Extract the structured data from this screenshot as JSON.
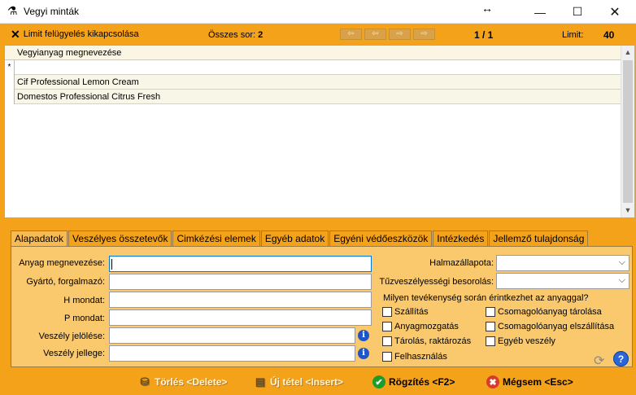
{
  "window": {
    "title": "Vegyi minták",
    "resize_glyph": "↔",
    "minimize_glyph": "—",
    "maximize_glyph": "☐",
    "close_glyph": "✕"
  },
  "toolbar": {
    "limit_toggle_label": "Limit felügyelés kikapcsolása",
    "total_label": "Összes sor:",
    "total_value": "2",
    "page": "1 / 1",
    "limit_label": "Limit:",
    "limit_value": "40",
    "nav_first": "⇦",
    "nav_prev": "⇦",
    "nav_next": "⇨",
    "nav_last": "⇨"
  },
  "grid": {
    "column_header": "Vegyianyag megnevezése",
    "new_row_marker": "*",
    "rows": [
      {
        "name": "Cif Professional Lemon Cream"
      },
      {
        "name": "Domestos Professional Citrus Fresh"
      }
    ]
  },
  "tabs": [
    {
      "label": "Alapadatok",
      "active": true
    },
    {
      "label": "Veszélyes összetevők"
    },
    {
      "label": "Cimkézési elemek"
    },
    {
      "label": "Egyéb adatok"
    },
    {
      "label": "Egyéni védőeszközök"
    },
    {
      "label": "Intézkedés"
    },
    {
      "label": "Jellemző tulajdonság"
    }
  ],
  "form": {
    "anyag_label": "Anyag megnevezése:",
    "anyag_value": "",
    "gyarto_label": "Gyártó, forgalmazó:",
    "gyarto_value": "",
    "h_label": "H mondat:",
    "h_value": "",
    "p_label": "P mondat:",
    "p_value": "",
    "jeloles_label": "Veszély jelölése:",
    "jeloles_value": "",
    "jelleg_label": "Veszély jellege:",
    "jelleg_value": "",
    "halmazallapot_label": "Halmazállapota:",
    "halmazallapot_value": "",
    "tuzveszely_label": "Tűzveszélyességi besorolás:",
    "tuzveszely_value": "",
    "question": "Milyen tevékenység során érintkezhet az anyaggal?",
    "checkboxes_left": [
      "Szállítás",
      "Anyagmozgatás",
      "Tárolás, raktározás",
      "Felhasználás"
    ],
    "checkboxes_right": [
      "Csomagolóanyag tárolása",
      "Csomagolóanyag elszállítása",
      "Egyéb veszély"
    ],
    "info_glyph": "i",
    "chevron_glyph": "⌵"
  },
  "bottom": {
    "delete_label": "Törlés <Delete>",
    "new_label": "Új tétel <Insert>",
    "save_label": "Rögzítés <F2>",
    "cancel_label": "Mégsem <Esc>",
    "help_glyph": "?"
  },
  "colors": {
    "frame": "#f3a21a",
    "panel": "#fac96e",
    "row_bg": "#f8f6e6"
  }
}
